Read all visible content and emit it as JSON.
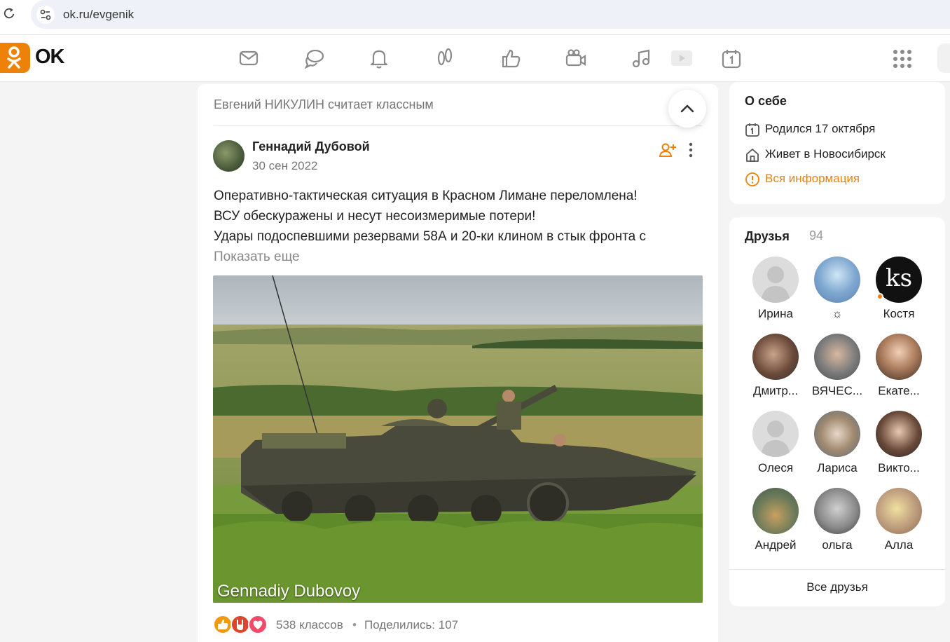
{
  "browser": {
    "url": "ok.ru/evgenik"
  },
  "header": {
    "logo_text": "OK",
    "nav_icons": [
      "messages-icon",
      "discussions-icon",
      "notifications-icon",
      "guests-icon",
      "marks-icon",
      "video-call-icon",
      "music-icon",
      "video-icon",
      "events-icon"
    ],
    "accent": "#ee8208"
  },
  "feed": {
    "header": "Евгений НИКУЛИН считает классным",
    "post": {
      "author": "Геннадий Дубовой",
      "date": "30 сен 2022",
      "lines": [
        "Оперативно-тактическая ситуация в Красном Лимане переломлена!",
        "ВСУ обескуражены и несут несоизмеримые потери!",
        "Удары подоспевшими резервами 58А и 20-ки клином в стык фронта с"
      ],
      "show_more": "Показать еще",
      "image_watermark": "Gennadiy Dubovoy",
      "likes": "538 классов",
      "separator": "•",
      "shares": "Поделились: 107"
    }
  },
  "about": {
    "title": "О себе",
    "birthday": "Родился 17 октября",
    "location": "Живет в Новосибирск",
    "all_info": "Вся информация"
  },
  "friends": {
    "title": "Друзья",
    "count": "94",
    "list": [
      {
        "name": "Ирина"
      },
      {
        "name": "☼"
      },
      {
        "name": "Костя",
        "avatar_text": "ks"
      },
      {
        "name": "Дмитр..."
      },
      {
        "name": "ВЯЧЕС..."
      },
      {
        "name": "Екате..."
      },
      {
        "name": "Олеся"
      },
      {
        "name": "Лариса"
      },
      {
        "name": "Викто..."
      },
      {
        "name": "Андрей"
      },
      {
        "name": "ольга"
      },
      {
        "name": "Алла"
      }
    ],
    "all_friends": "Все друзья"
  }
}
